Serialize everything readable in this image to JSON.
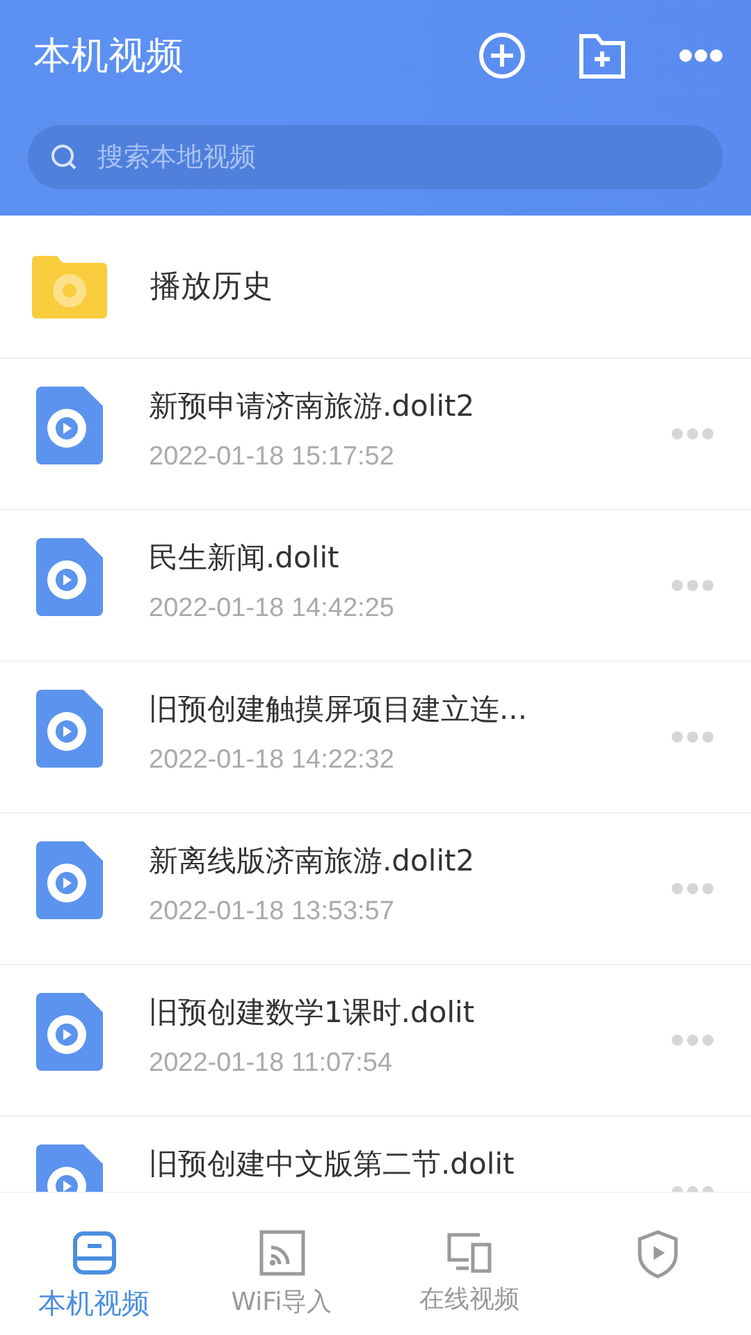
{
  "header": {
    "title": "本机视频",
    "search": {
      "placeholder": "搜索本地视频"
    }
  },
  "history": {
    "label": "播放历史"
  },
  "videos": [
    {
      "title": "新预申请济南旅游.dolit2",
      "date": "2022-01-18 15:17:52"
    },
    {
      "title": "民生新闻.dolit",
      "date": "2022-01-18 14:42:25"
    },
    {
      "title": "旧预创建触摸屏项目建立连...",
      "date": "2022-01-18 14:22:32"
    },
    {
      "title": "新离线版济南旅游.dolit2",
      "date": "2022-01-18 13:53:57"
    },
    {
      "title": "旧预创建数学1课时.dolit",
      "date": "2022-01-18 11:07:54"
    },
    {
      "title": "旧预创建中文版第二节.dolit"
    }
  ],
  "tabs": [
    {
      "kind": "drive",
      "label": "本机视频",
      "selected": true
    },
    {
      "kind": "cast",
      "label": "WiFi导入",
      "selected": false
    },
    {
      "kind": "devices",
      "label": "在线视频",
      "selected": false
    },
    {
      "kind": "shield",
      "selected": false
    }
  ]
}
